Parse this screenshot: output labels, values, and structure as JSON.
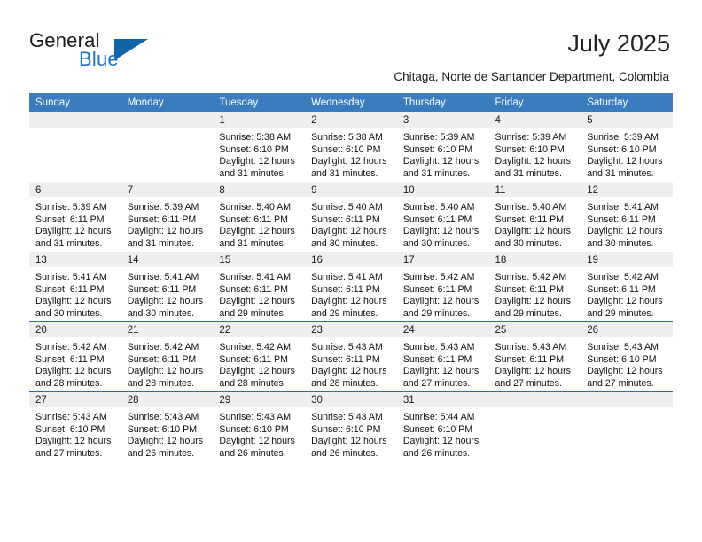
{
  "brand": {
    "name_top": "General",
    "name_bottom": "Blue",
    "color_top": "#1b1b1b",
    "color_bottom": "#1d73bd",
    "triangle_color": "#1064a8"
  },
  "header": {
    "title": "July 2025",
    "subtitle": "Chitaga, Norte de Santander Department, Colombia"
  },
  "theme": {
    "header_blue": "#3a7cbe",
    "row_divider_blue": "#2b6cad",
    "daynum_band": "#efefef",
    "cell_bg": "#ffffff",
    "text": "#111111"
  },
  "calendar": {
    "weekday_headers": [
      "Sunday",
      "Monday",
      "Tuesday",
      "Wednesday",
      "Thursday",
      "Friday",
      "Saturday"
    ],
    "weeks": [
      [
        {
          "day": "",
          "sunrise": "",
          "sunset": "",
          "daylight_line1": "",
          "daylight_line2": "",
          "empty": true
        },
        {
          "day": "",
          "sunrise": "",
          "sunset": "",
          "daylight_line1": "",
          "daylight_line2": "",
          "empty": true
        },
        {
          "day": "1",
          "sunrise": "Sunrise: 5:38 AM",
          "sunset": "Sunset: 6:10 PM",
          "daylight_line1": "Daylight: 12 hours",
          "daylight_line2": "and 31 minutes."
        },
        {
          "day": "2",
          "sunrise": "Sunrise: 5:38 AM",
          "sunset": "Sunset: 6:10 PM",
          "daylight_line1": "Daylight: 12 hours",
          "daylight_line2": "and 31 minutes."
        },
        {
          "day": "3",
          "sunrise": "Sunrise: 5:39 AM",
          "sunset": "Sunset: 6:10 PM",
          "daylight_line1": "Daylight: 12 hours",
          "daylight_line2": "and 31 minutes."
        },
        {
          "day": "4",
          "sunrise": "Sunrise: 5:39 AM",
          "sunset": "Sunset: 6:10 PM",
          "daylight_line1": "Daylight: 12 hours",
          "daylight_line2": "and 31 minutes."
        },
        {
          "day": "5",
          "sunrise": "Sunrise: 5:39 AM",
          "sunset": "Sunset: 6:10 PM",
          "daylight_line1": "Daylight: 12 hours",
          "daylight_line2": "and 31 minutes."
        }
      ],
      [
        {
          "day": "6",
          "sunrise": "Sunrise: 5:39 AM",
          "sunset": "Sunset: 6:11 PM",
          "daylight_line1": "Daylight: 12 hours",
          "daylight_line2": "and 31 minutes."
        },
        {
          "day": "7",
          "sunrise": "Sunrise: 5:39 AM",
          "sunset": "Sunset: 6:11 PM",
          "daylight_line1": "Daylight: 12 hours",
          "daylight_line2": "and 31 minutes."
        },
        {
          "day": "8",
          "sunrise": "Sunrise: 5:40 AM",
          "sunset": "Sunset: 6:11 PM",
          "daylight_line1": "Daylight: 12 hours",
          "daylight_line2": "and 31 minutes."
        },
        {
          "day": "9",
          "sunrise": "Sunrise: 5:40 AM",
          "sunset": "Sunset: 6:11 PM",
          "daylight_line1": "Daylight: 12 hours",
          "daylight_line2": "and 30 minutes."
        },
        {
          "day": "10",
          "sunrise": "Sunrise: 5:40 AM",
          "sunset": "Sunset: 6:11 PM",
          "daylight_line1": "Daylight: 12 hours",
          "daylight_line2": "and 30 minutes."
        },
        {
          "day": "11",
          "sunrise": "Sunrise: 5:40 AM",
          "sunset": "Sunset: 6:11 PM",
          "daylight_line1": "Daylight: 12 hours",
          "daylight_line2": "and 30 minutes."
        },
        {
          "day": "12",
          "sunrise": "Sunrise: 5:41 AM",
          "sunset": "Sunset: 6:11 PM",
          "daylight_line1": "Daylight: 12 hours",
          "daylight_line2": "and 30 minutes."
        }
      ],
      [
        {
          "day": "13",
          "sunrise": "Sunrise: 5:41 AM",
          "sunset": "Sunset: 6:11 PM",
          "daylight_line1": "Daylight: 12 hours",
          "daylight_line2": "and 30 minutes."
        },
        {
          "day": "14",
          "sunrise": "Sunrise: 5:41 AM",
          "sunset": "Sunset: 6:11 PM",
          "daylight_line1": "Daylight: 12 hours",
          "daylight_line2": "and 30 minutes."
        },
        {
          "day": "15",
          "sunrise": "Sunrise: 5:41 AM",
          "sunset": "Sunset: 6:11 PM",
          "daylight_line1": "Daylight: 12 hours",
          "daylight_line2": "and 29 minutes."
        },
        {
          "day": "16",
          "sunrise": "Sunrise: 5:41 AM",
          "sunset": "Sunset: 6:11 PM",
          "daylight_line1": "Daylight: 12 hours",
          "daylight_line2": "and 29 minutes."
        },
        {
          "day": "17",
          "sunrise": "Sunrise: 5:42 AM",
          "sunset": "Sunset: 6:11 PM",
          "daylight_line1": "Daylight: 12 hours",
          "daylight_line2": "and 29 minutes."
        },
        {
          "day": "18",
          "sunrise": "Sunrise: 5:42 AM",
          "sunset": "Sunset: 6:11 PM",
          "daylight_line1": "Daylight: 12 hours",
          "daylight_line2": "and 29 minutes."
        },
        {
          "day": "19",
          "sunrise": "Sunrise: 5:42 AM",
          "sunset": "Sunset: 6:11 PM",
          "daylight_line1": "Daylight: 12 hours",
          "daylight_line2": "and 29 minutes."
        }
      ],
      [
        {
          "day": "20",
          "sunrise": "Sunrise: 5:42 AM",
          "sunset": "Sunset: 6:11 PM",
          "daylight_line1": "Daylight: 12 hours",
          "daylight_line2": "and 28 minutes."
        },
        {
          "day": "21",
          "sunrise": "Sunrise: 5:42 AM",
          "sunset": "Sunset: 6:11 PM",
          "daylight_line1": "Daylight: 12 hours",
          "daylight_line2": "and 28 minutes."
        },
        {
          "day": "22",
          "sunrise": "Sunrise: 5:42 AM",
          "sunset": "Sunset: 6:11 PM",
          "daylight_line1": "Daylight: 12 hours",
          "daylight_line2": "and 28 minutes."
        },
        {
          "day": "23",
          "sunrise": "Sunrise: 5:43 AM",
          "sunset": "Sunset: 6:11 PM",
          "daylight_line1": "Daylight: 12 hours",
          "daylight_line2": "and 28 minutes."
        },
        {
          "day": "24",
          "sunrise": "Sunrise: 5:43 AM",
          "sunset": "Sunset: 6:11 PM",
          "daylight_line1": "Daylight: 12 hours",
          "daylight_line2": "and 27 minutes."
        },
        {
          "day": "25",
          "sunrise": "Sunrise: 5:43 AM",
          "sunset": "Sunset: 6:11 PM",
          "daylight_line1": "Daylight: 12 hours",
          "daylight_line2": "and 27 minutes."
        },
        {
          "day": "26",
          "sunrise": "Sunrise: 5:43 AM",
          "sunset": "Sunset: 6:10 PM",
          "daylight_line1": "Daylight: 12 hours",
          "daylight_line2": "and 27 minutes."
        }
      ],
      [
        {
          "day": "27",
          "sunrise": "Sunrise: 5:43 AM",
          "sunset": "Sunset: 6:10 PM",
          "daylight_line1": "Daylight: 12 hours",
          "daylight_line2": "and 27 minutes."
        },
        {
          "day": "28",
          "sunrise": "Sunrise: 5:43 AM",
          "sunset": "Sunset: 6:10 PM",
          "daylight_line1": "Daylight: 12 hours",
          "daylight_line2": "and 26 minutes."
        },
        {
          "day": "29",
          "sunrise": "Sunrise: 5:43 AM",
          "sunset": "Sunset: 6:10 PM",
          "daylight_line1": "Daylight: 12 hours",
          "daylight_line2": "and 26 minutes."
        },
        {
          "day": "30",
          "sunrise": "Sunrise: 5:43 AM",
          "sunset": "Sunset: 6:10 PM",
          "daylight_line1": "Daylight: 12 hours",
          "daylight_line2": "and 26 minutes."
        },
        {
          "day": "31",
          "sunrise": "Sunrise: 5:44 AM",
          "sunset": "Sunset: 6:10 PM",
          "daylight_line1": "Daylight: 12 hours",
          "daylight_line2": "and 26 minutes."
        },
        {
          "day": "",
          "sunrise": "",
          "sunset": "",
          "daylight_line1": "",
          "daylight_line2": "",
          "empty": true
        },
        {
          "day": "",
          "sunrise": "",
          "sunset": "",
          "daylight_line1": "",
          "daylight_line2": "",
          "empty": true
        }
      ]
    ]
  }
}
